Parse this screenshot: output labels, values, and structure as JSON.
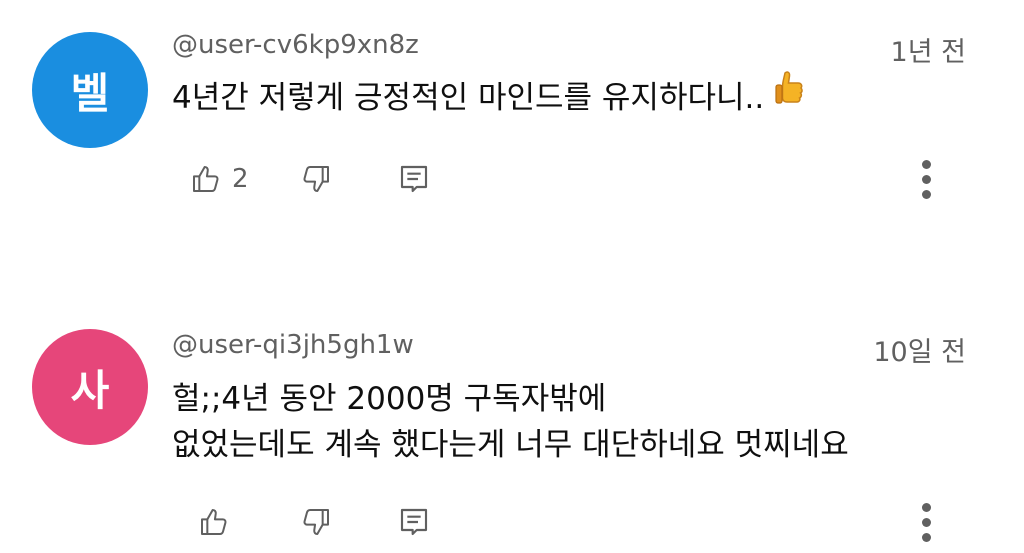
{
  "comments": [
    {
      "avatar_letter": "벨",
      "avatar_color": "#1a8ee0",
      "username": "@user-cv6kp9xn8z",
      "time": "1년 전",
      "lines": [
        "4년간 저렇게 긍정적인 마인드를 유지하다니.."
      ],
      "emoji": "thumbs-up-emoji",
      "like_count": "2"
    },
    {
      "avatar_letter": "사",
      "avatar_color": "#e6467a",
      "username": "@user-qi3jh5gh1w",
      "time": "10일 전",
      "lines": [
        "헐;;4년 동안 2000명 구독자밖에",
        "없었는데도 계속 했다는게 너무 대단하네요 멋찌네요"
      ],
      "like_count": ""
    }
  ],
  "icons": {
    "like": "thumbs-up-icon",
    "dislike": "thumbs-down-icon",
    "reply": "reply-icon",
    "more": "more-vert-icon"
  }
}
